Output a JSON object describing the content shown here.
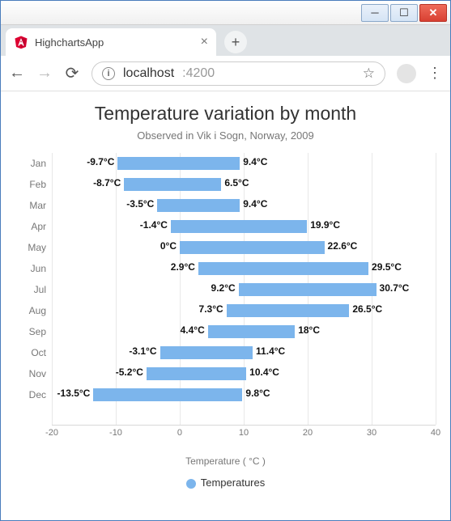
{
  "window": {
    "minimize": "─",
    "maximize": "☐",
    "close": "✕"
  },
  "browser": {
    "tab_title": "HighchartsApp",
    "url_host": "localhost",
    "url_port": ":4200"
  },
  "chart_data": {
    "type": "bar",
    "title": "Temperature variation by month",
    "subtitle": "Observed in Vik i Sogn, Norway, 2009",
    "xlabel": "Temperature ( °C )",
    "ylabel": "",
    "xlim": [
      -20,
      40
    ],
    "xticks": [
      -20,
      -10,
      0,
      10,
      20,
      30,
      40
    ],
    "legend": "Temperatures",
    "categories": [
      "Jan",
      "Feb",
      "Mar",
      "Apr",
      "May",
      "Jun",
      "Jul",
      "Aug",
      "Sep",
      "Oct",
      "Nov",
      "Dec"
    ],
    "series": [
      {
        "name": "Temperatures",
        "ranges": [
          {
            "low": -9.7,
            "high": 9.4
          },
          {
            "low": -8.7,
            "high": 6.5
          },
          {
            "low": -3.5,
            "high": 9.4
          },
          {
            "low": -1.4,
            "high": 19.9
          },
          {
            "low": 0.0,
            "high": 22.6
          },
          {
            "low": 2.9,
            "high": 29.5
          },
          {
            "low": 9.2,
            "high": 30.7
          },
          {
            "low": 7.3,
            "high": 26.5
          },
          {
            "low": 4.4,
            "high": 18.0
          },
          {
            "low": -3.1,
            "high": 11.4
          },
          {
            "low": -5.2,
            "high": 10.4
          },
          {
            "low": -13.5,
            "high": 9.8
          }
        ]
      }
    ],
    "unit": "°C"
  }
}
